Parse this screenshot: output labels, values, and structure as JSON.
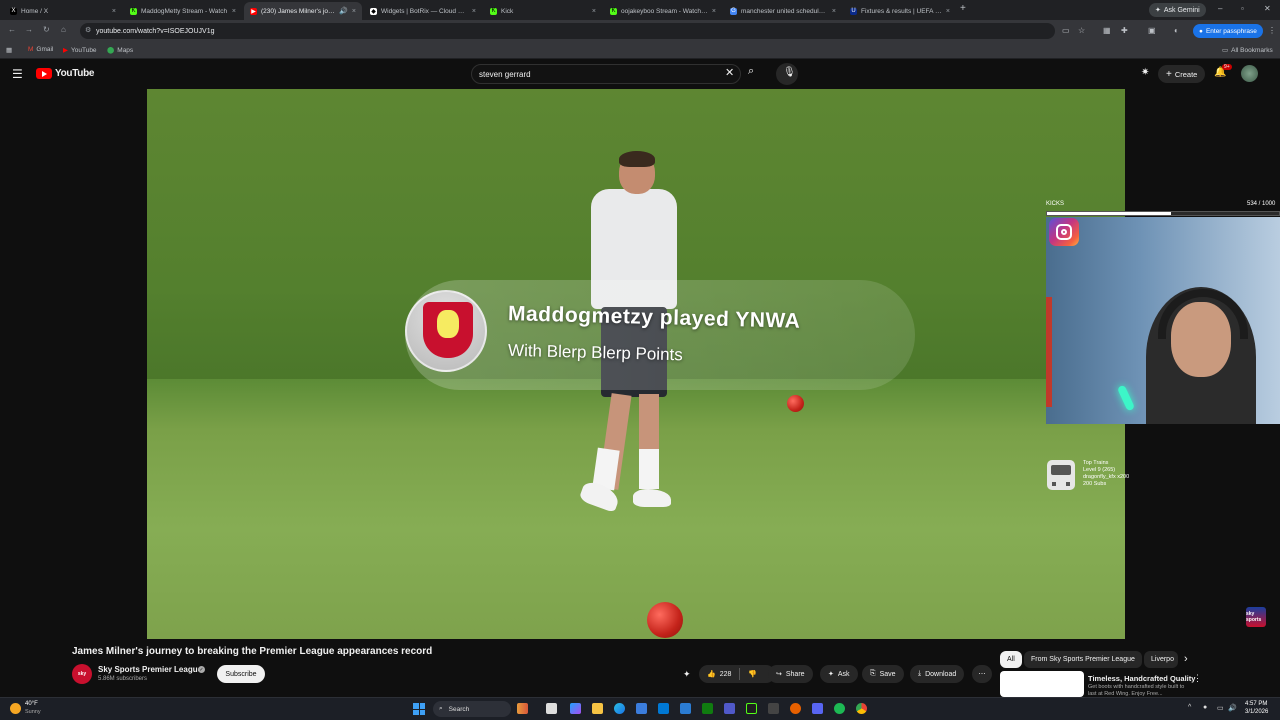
{
  "browser": {
    "tabs": [
      {
        "title": "Home / X",
        "favicon": "X",
        "color": "#000000",
        "active": false
      },
      {
        "title": "MaddogMetty Stream - Watch",
        "favicon": "K",
        "color": "#53fc18",
        "active": false
      },
      {
        "title": "(230) James Milner's journe",
        "favicon": "▶",
        "color": "#ff0000",
        "active": true
      },
      {
        "title": "Widgets | BotRix — Cloud Stream",
        "favicon": "◆",
        "color": "#ffffff",
        "active": false
      },
      {
        "title": "Kick",
        "favicon": "K",
        "color": "#53fc18",
        "active": false
      },
      {
        "title": "oojakeyboo Stream - Watch Live",
        "favicon": "K",
        "color": "#53fc18",
        "active": false
      },
      {
        "title": "manchester united schedule - G",
        "favicon": "G",
        "color": "#4285f4",
        "active": false
      },
      {
        "title": "Fixtures & results | UEFA Champ",
        "favicon": "U",
        "color": "#0a2a8a",
        "active": false
      }
    ],
    "ask_gemini": "Ask Gemini",
    "url": "youtube.com/watch?v=ISOEJOUJV1g",
    "enter_passphrase": "Enter passphrase",
    "bookmarks": [
      "Gmail",
      "YouTube",
      "Maps"
    ],
    "all_bookmarks": "All Bookmarks"
  },
  "youtube": {
    "logo_text": "YouTube",
    "search_value": "steven gerrard",
    "create_label": "Create",
    "notification_badge": "9+"
  },
  "overlay": {
    "alert_title": "Maddogmetzy played YNWA",
    "alert_subtitle": "With Blerp Blerp Points",
    "kicks_label": "KICKS",
    "kicks_count": "534 / 1000",
    "kicks_progress": 0.534,
    "top_train_lines": [
      "Top Trains",
      "Level 9 (265)",
      "dragonfly_kfx x200",
      "200 Subs"
    ],
    "sky_logo": "sky sports"
  },
  "video": {
    "title": "James Milner's journey to breaking the Premier League appearances record",
    "channel_name": "Sky Sports Premier League",
    "channel_subs": "5.86M subscribers",
    "subscribe_label": "Subscribe",
    "likes": "228",
    "share_label": "Share",
    "ask_label": "Ask",
    "save_label": "Save",
    "download_label": "Download"
  },
  "sidebar": {
    "chips": [
      "All",
      "From Sky Sports Premier League",
      "Liverpo"
    ],
    "ad_title": "Timeless, Handcrafted Quality",
    "ad_desc": "Get boots with handcrafted style built to last at Red Wing. Enjoy Free..."
  },
  "taskbar": {
    "weather_temp": "40°F",
    "weather_desc": "Sunny",
    "search_label": "Search",
    "time": "4:57 PM",
    "date": "3/1/2026"
  }
}
